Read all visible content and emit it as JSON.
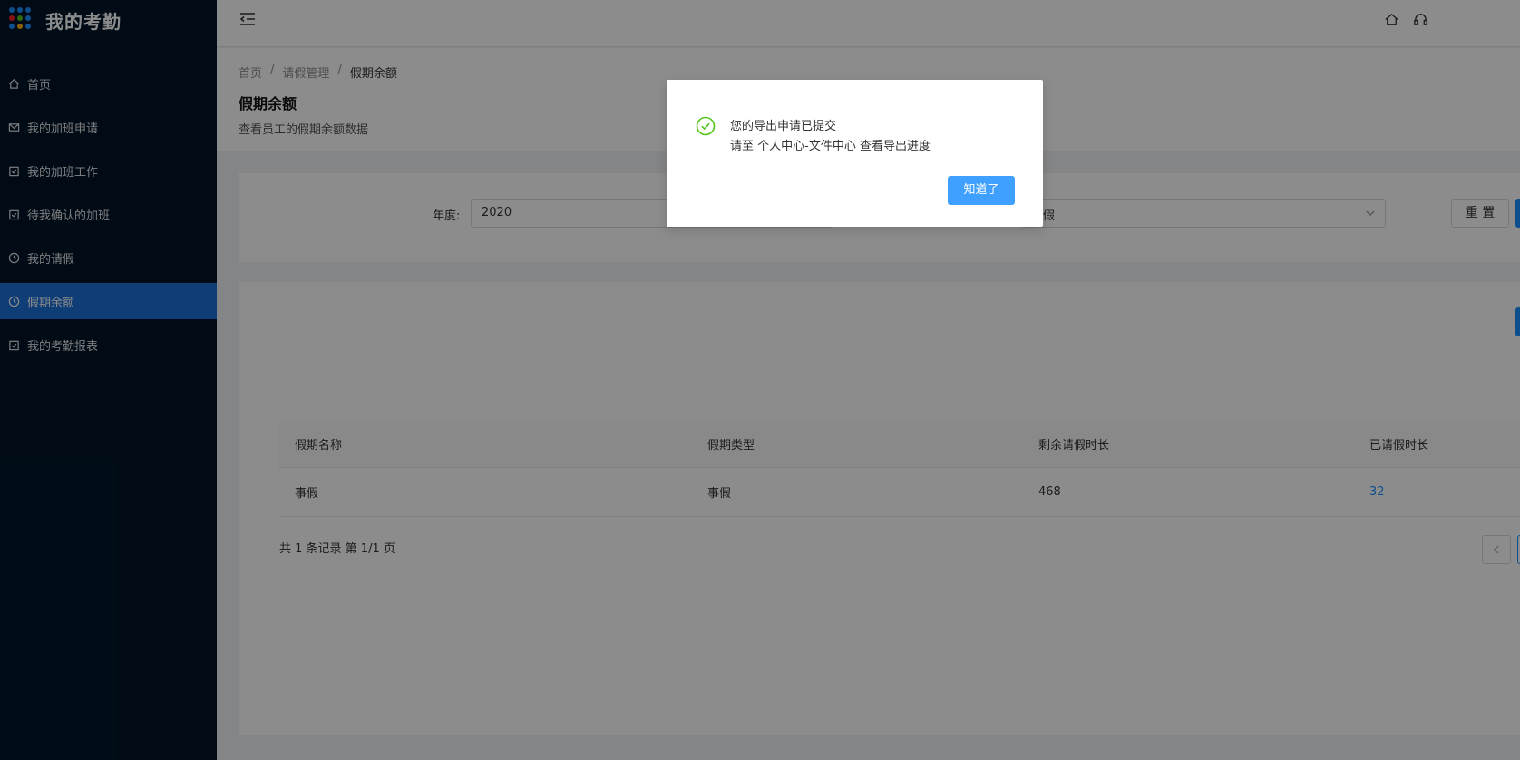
{
  "app": {
    "title": "我的考勤"
  },
  "sidebar": {
    "items": [
      {
        "label": "首页",
        "icon": "home-icon"
      },
      {
        "label": "我的加班申请",
        "icon": "mail-icon"
      },
      {
        "label": "我的加班工作",
        "icon": "calendar-check-icon"
      },
      {
        "label": "待我确认的加班",
        "icon": "calendar-check-icon"
      },
      {
        "label": "我的请假",
        "icon": "clock-icon"
      },
      {
        "label": "假期余额",
        "icon": "clock-icon",
        "active": true
      },
      {
        "label": "我的考勤报表",
        "icon": "calendar-check-icon"
      }
    ]
  },
  "breadcrumb": {
    "items": [
      "首页",
      "请假管理",
      "假期余额"
    ],
    "separator": "/"
  },
  "page": {
    "title": "假期余额",
    "description": "查看员工的假期余额数据"
  },
  "filter": {
    "year_label": "年度:",
    "year_value": "2020",
    "type_value": "事假",
    "reset_label": "重 置"
  },
  "table": {
    "columns": [
      "假期名称",
      "假期类型",
      "剩余请假时长",
      "已请假时长"
    ],
    "rows": [
      {
        "name": "事假",
        "type": "事假",
        "remaining": "468",
        "used": "32"
      }
    ]
  },
  "pagination": {
    "summary": "共 1 条记录 第 1/1 页"
  },
  "modal": {
    "line1": "您的导出申请已提交",
    "line2": "请至 个人中心-文件中心 查看导出进度",
    "ok_label": "知道了",
    "icon": "check-circle-icon"
  },
  "colors": {
    "sidebar_bg": "#001529",
    "active_item": "#1d6fd6",
    "primary": "#1890ff",
    "success": "#52c41a"
  }
}
